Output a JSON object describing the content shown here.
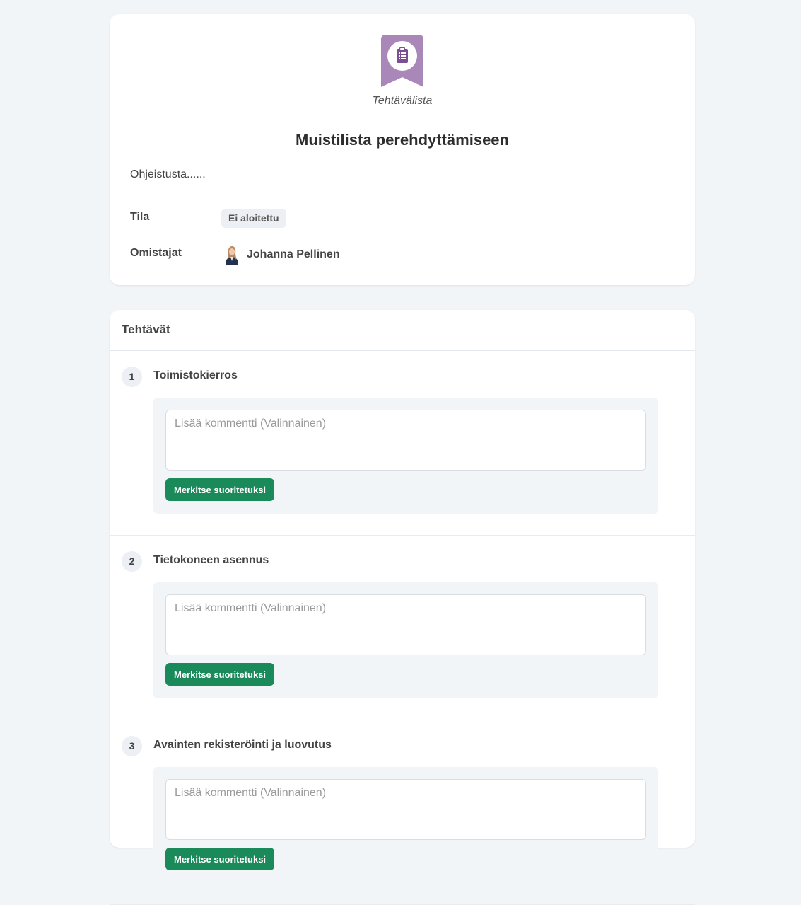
{
  "header": {
    "type_label": "Tehtävälista",
    "title": "Muistilista perehdyttämiseen",
    "description": "Ohjeistusta......",
    "status_label": "Tila",
    "status_value": "Ei aloitettu",
    "owners_label": "Omistajat",
    "owner_name": "Johanna Pellinen",
    "icon": "clipboard-list-icon",
    "icon_color": "#a987b8"
  },
  "tasks": {
    "title": "Tehtävät",
    "comment_placeholder": "Lisää kommentti (Valinnainen)",
    "complete_label": "Merkitse suoritetuksi",
    "button_color": "#1b8a5a",
    "items": [
      {
        "number": "1",
        "title": "Toimistokierros"
      },
      {
        "number": "2",
        "title": "Tietokoneen asennus"
      },
      {
        "number": "3",
        "title": "Avainten rekisteröinti ja luovutus"
      }
    ]
  }
}
